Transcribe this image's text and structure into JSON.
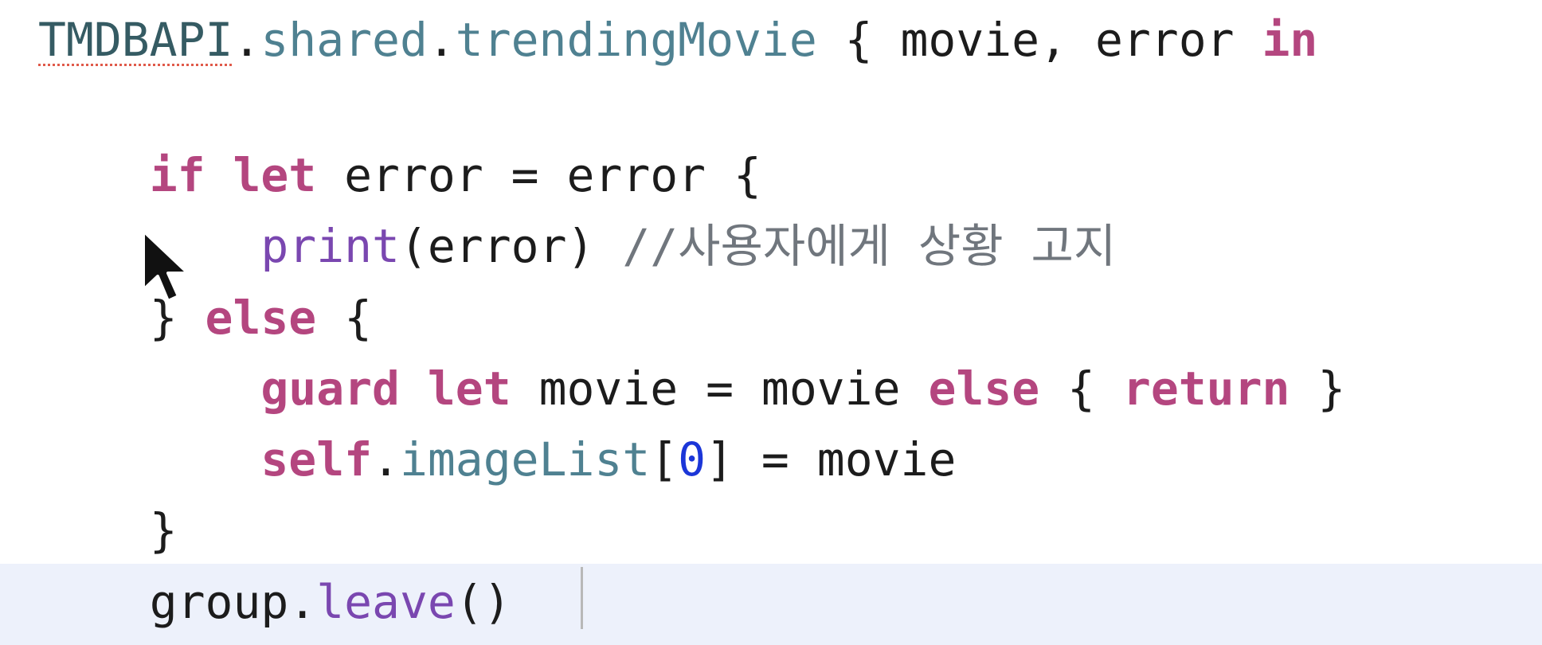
{
  "editor": {
    "language": "Swift",
    "colors": {
      "keyword": "#b4467f",
      "method": "#4f8191",
      "type": "#355b63",
      "library_call": "#7a47b0",
      "comment": "#70767d",
      "number": "#1b36d8",
      "current_line_highlight": "#edf1fb",
      "warning_underline": "#e05a4a"
    },
    "lines": [
      {
        "indent": "",
        "tokens": [
          {
            "text": "TMDBAPI",
            "kind": "type",
            "underline": "warning"
          },
          {
            "text": ".",
            "kind": "plain"
          },
          {
            "text": "shared",
            "kind": "method"
          },
          {
            "text": ".",
            "kind": "plain"
          },
          {
            "text": "trendingMovie",
            "kind": "method"
          },
          {
            "text": " { movie, error ",
            "kind": "plain"
          },
          {
            "text": "in",
            "kind": "keyword"
          }
        ]
      },
      {
        "indent": "",
        "tokens": []
      },
      {
        "indent": "    ",
        "tokens": [
          {
            "text": "if",
            "kind": "keyword"
          },
          {
            "text": " ",
            "kind": "plain"
          },
          {
            "text": "let",
            "kind": "keyword"
          },
          {
            "text": " error = error {",
            "kind": "plain"
          }
        ]
      },
      {
        "indent": "        ",
        "tokens": [
          {
            "text": "print",
            "kind": "library_call"
          },
          {
            "text": "(error) ",
            "kind": "plain"
          },
          {
            "text": "//사용자에게 상황 고지",
            "kind": "comment"
          }
        ]
      },
      {
        "indent": "    ",
        "tokens": [
          {
            "text": "} ",
            "kind": "plain"
          },
          {
            "text": "else",
            "kind": "keyword"
          },
          {
            "text": " {",
            "kind": "plain"
          }
        ]
      },
      {
        "indent": "        ",
        "tokens": [
          {
            "text": "guard",
            "kind": "keyword"
          },
          {
            "text": " ",
            "kind": "plain"
          },
          {
            "text": "let",
            "kind": "keyword"
          },
          {
            "text": " movie = movie ",
            "kind": "plain"
          },
          {
            "text": "else",
            "kind": "keyword"
          },
          {
            "text": " { ",
            "kind": "plain"
          },
          {
            "text": "return",
            "kind": "keyword"
          },
          {
            "text": " }",
            "kind": "plain"
          }
        ]
      },
      {
        "indent": "        ",
        "tokens": [
          {
            "text": "self",
            "kind": "keyword"
          },
          {
            "text": ".",
            "kind": "plain"
          },
          {
            "text": "imageList",
            "kind": "method"
          },
          {
            "text": "[",
            "kind": "plain"
          },
          {
            "text": "0",
            "kind": "number"
          },
          {
            "text": "] = movie",
            "kind": "plain"
          }
        ]
      },
      {
        "indent": "    ",
        "tokens": [
          {
            "text": "}",
            "kind": "plain"
          }
        ]
      },
      {
        "indent": "    ",
        "current": true,
        "tokens": [
          {
            "text": "group",
            "kind": "plain"
          },
          {
            "text": ".",
            "kind": "plain"
          },
          {
            "text": "leave",
            "kind": "library_call"
          },
          {
            "text": "()",
            "kind": "plain"
          }
        ]
      }
    ]
  },
  "cursor": {
    "icon": "mouse-pointer-icon"
  }
}
